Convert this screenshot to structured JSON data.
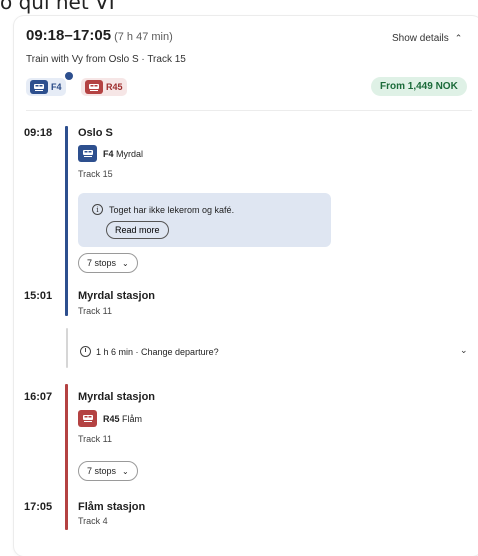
{
  "top_text": "o qui net VI",
  "header": {
    "time_range": "09:18–17:05",
    "duration": "(7 h 47 min)",
    "subtitle": "Train with Vy from Oslo S · Track 15",
    "show_details": "Show details",
    "badges": [
      {
        "label": "F4",
        "color": "#2d4f8e"
      },
      {
        "label": "R45",
        "color": "#b44242"
      }
    ],
    "price": "From 1,449 NOK"
  },
  "legs": [
    {
      "depart_time": "09:18",
      "depart_station": "Oslo S",
      "train_code": "F4",
      "destination": "Myrdal",
      "depart_track": "Track 15",
      "notice": "Toget har ikke lekerom og kafé.",
      "read_more": "Read more",
      "stops": "7 stops",
      "arrive_time": "15:01",
      "arrive_station": "Myrdal stasjon",
      "arrive_track": "Track 11"
    },
    {
      "depart_time": "16:07",
      "depart_station": "Myrdal stasjon",
      "train_code": "R45",
      "destination": "Flåm",
      "depart_track": "Track 11",
      "stops": "7 stops",
      "arrive_time": "17:05",
      "arrive_station": "Flåm stasjon",
      "arrive_track": "Track 4"
    }
  ],
  "change": {
    "text": "1 h 6 min · Change departure?"
  }
}
